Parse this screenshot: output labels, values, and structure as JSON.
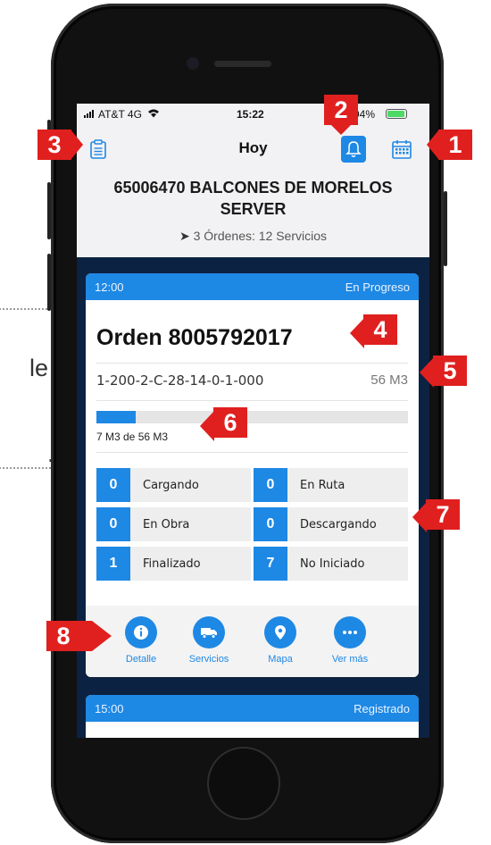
{
  "callout": {
    "line1": "le",
    "line2": "."
  },
  "status_bar": {
    "carrier": "AT&T 4G",
    "time": "15:22",
    "battery": "94%"
  },
  "nav": {
    "title": "Hoy"
  },
  "station": {
    "title": "65006470 BALCONES DE MORELOS SERVER",
    "summary": "3 Órdenes: 12 Servicios"
  },
  "order": {
    "time": "12:00",
    "status": "En Progreso",
    "title": "Orden 8005792017",
    "code": "1-200-2-C-28-14-0-1-000",
    "volume": "56 M3",
    "progress_label": "7 M3 de 56 M3",
    "progress_fraction": 0.125,
    "stats": [
      {
        "count": "0",
        "label": "Cargando"
      },
      {
        "count": "0",
        "label": "En Ruta"
      },
      {
        "count": "0",
        "label": "En Obra"
      },
      {
        "count": "0",
        "label": "Descargando"
      },
      {
        "count": "1",
        "label": "Finalizado"
      },
      {
        "count": "7",
        "label": "No Iniciado"
      }
    ],
    "actions": [
      {
        "label": "Detalle",
        "icon": "info-icon"
      },
      {
        "label": "Servicios",
        "icon": "truck-icon"
      },
      {
        "label": "Mapa",
        "icon": "map-pin-icon"
      },
      {
        "label": "Ver más",
        "icon": "more-icon"
      }
    ]
  },
  "next_order": {
    "time": "15:00",
    "status": "Registrado"
  },
  "markers": [
    "1",
    "2",
    "3",
    "4",
    "5",
    "6",
    "7",
    "8"
  ],
  "colors": {
    "accent": "#1e88e5",
    "marker": "#e0201f",
    "screen_bg": "#0c2242"
  }
}
